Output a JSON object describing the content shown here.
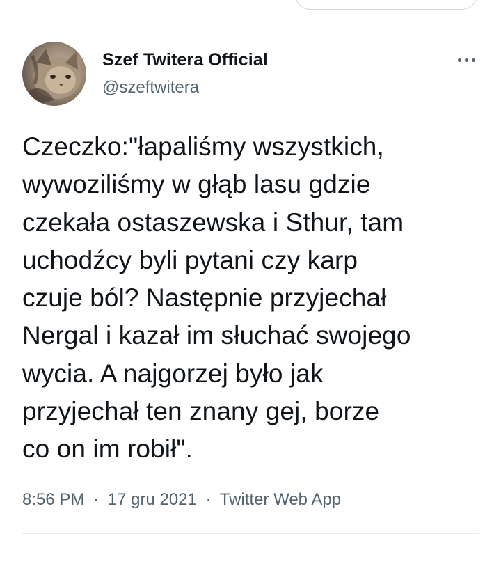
{
  "tweet": {
    "author": {
      "display_name": "Szef Twitera Official",
      "handle": "@szeftwitera",
      "avatar_icon": "cat-avatar-icon"
    },
    "more_icon": "more-horizontal-icon",
    "text": "Czeczko:\"łapaliśmy wszystkich,\nwywoziliśmy w głąb lasu gdzie\nczekała ostaszewska i Sthur, tam\nuchodźcy byli pytani czy karp\nczuje ból? Następnie przyjechał\nNergal i kazał im słuchać swojego\nwycia. A najgorzej było jak\nprzyjechał ten znany gej, borze\nco on im robił\".",
    "time": "8:56 PM",
    "date": "17 gru 2021",
    "separator": "·",
    "client": "Twitter Web App"
  },
  "colors": {
    "text_primary": "#0f1419",
    "text_secondary": "#536471",
    "divider": "#e6ebee"
  }
}
